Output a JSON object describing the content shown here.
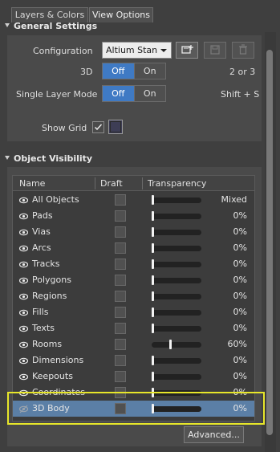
{
  "tabs": [
    {
      "label": "Layers & Colors",
      "active": false
    },
    {
      "label": "View Options",
      "active": true
    }
  ],
  "general": {
    "header": "General Settings",
    "configuration_label": "Configuration",
    "configuration_value": "Altium Stan",
    "threed_label": "3D",
    "threed_shortcut": "2 or 3",
    "single_layer_label": "Single Layer Mode",
    "single_layer_shortcut": "Shift + S",
    "off_label": "Off",
    "on_label": "On",
    "show_grid_label": "Show Grid"
  },
  "visibility": {
    "header": "Object Visibility",
    "columns": {
      "name": "Name",
      "draft": "Draft",
      "transparency": "Transparency"
    },
    "rows": [
      {
        "name": "All Objects",
        "value": "Mixed",
        "level": 0
      },
      {
        "name": "Pads",
        "value": "0%",
        "level": 0
      },
      {
        "name": "Vias",
        "value": "0%",
        "level": 0
      },
      {
        "name": "Arcs",
        "value": "0%",
        "level": 0
      },
      {
        "name": "Tracks",
        "value": "0%",
        "level": 0
      },
      {
        "name": "Polygons",
        "value": "0%",
        "level": 0
      },
      {
        "name": "Regions",
        "value": "0%",
        "level": 0
      },
      {
        "name": "Fills",
        "value": "0%",
        "level": 0
      },
      {
        "name": "Texts",
        "value": "0%",
        "level": 0
      },
      {
        "name": "Rooms",
        "value": "60%",
        "level": 0.6
      },
      {
        "name": "Dimensions",
        "value": "0%",
        "level": 0
      },
      {
        "name": "Keepouts",
        "value": "0%",
        "level": 0
      },
      {
        "name": "Coordinates",
        "value": "0%",
        "level": 0
      },
      {
        "name": "3D Body",
        "value": "0%",
        "level": 0
      }
    ],
    "advanced_button": "Advanced..."
  },
  "colors": {
    "accent": "#3f7ac4",
    "selected_row": "#5b7fa6",
    "highlight": "#e7e62a"
  }
}
